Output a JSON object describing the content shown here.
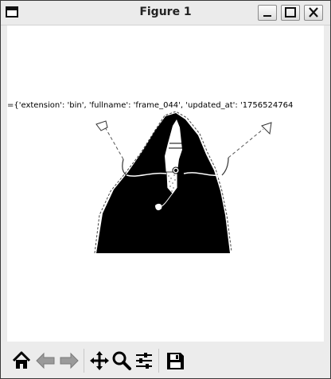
{
  "window": {
    "title": "Figure 1"
  },
  "figure": {
    "header_text": "={'extension': 'bin', 'fullname': 'frame_044', 'updated_at': '1756524764"
  },
  "toolbar": {
    "items": [
      {
        "name": "home",
        "icon": "home-icon"
      },
      {
        "name": "back",
        "icon": "arrow-left-icon"
      },
      {
        "name": "forward",
        "icon": "arrow-right-icon"
      },
      {
        "name": "pan",
        "icon": "move-icon"
      },
      {
        "name": "zoom",
        "icon": "magnifier-icon"
      },
      {
        "name": "configure-subplots",
        "icon": "sliders-icon"
      },
      {
        "name": "save",
        "icon": "floppy-disk-icon"
      }
    ]
  }
}
